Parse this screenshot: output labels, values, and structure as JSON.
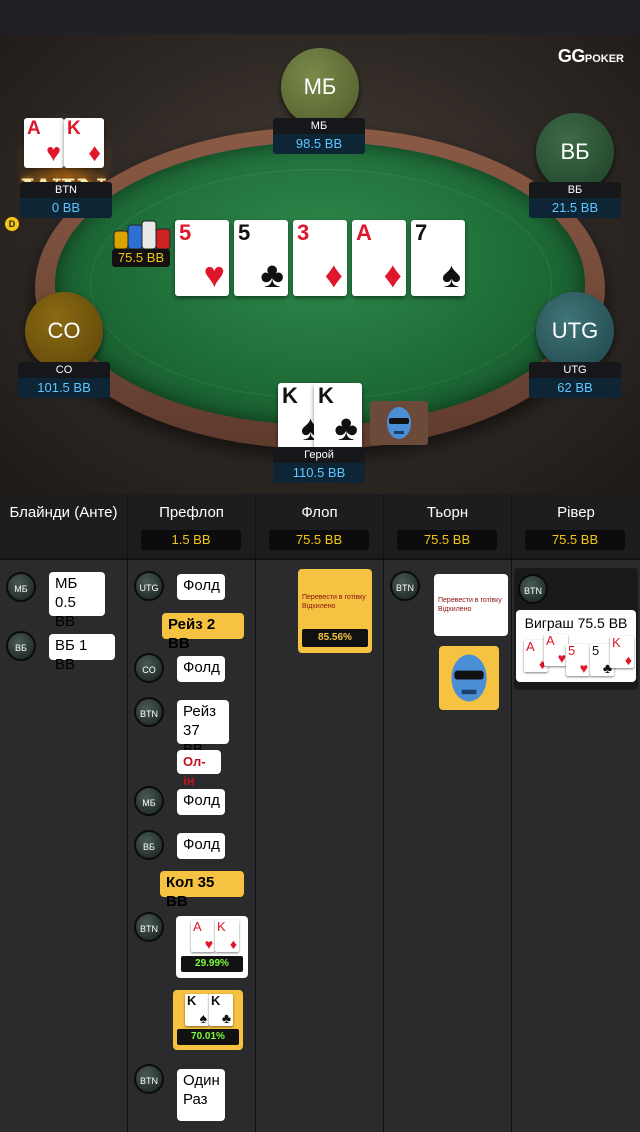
{
  "brand": {
    "logo": "GG",
    "logo_sub": "POKER"
  },
  "seats": {
    "sb": {
      "circle": "МБ",
      "name": "МБ",
      "stack": "98.5 BB"
    },
    "bb": {
      "circle": "ВБ",
      "name": "ВБ",
      "stack": "21.5 BB"
    },
    "utg": {
      "circle": "UTG",
      "name": "UTG",
      "stack": "62 BB"
    },
    "co": {
      "circle": "CO",
      "name": "CO",
      "stack": "101.5 BB"
    },
    "btn": {
      "name": "BTN",
      "stack": "0 BB",
      "win": "WIN",
      "dealer": "D",
      "cards": [
        {
          "rank": "A",
          "suit": "♥"
        },
        {
          "rank": "K",
          "suit": "♦"
        }
      ]
    },
    "hero": {
      "name": "Герой",
      "stack": "110.5 BB",
      "cards": [
        {
          "rank": "K",
          "suit": "♠"
        },
        {
          "rank": "K",
          "suit": "♣"
        }
      ]
    }
  },
  "pot": "75.5 BB",
  "board": [
    {
      "rank": "5",
      "suit": "♥",
      "color": "#e0162b"
    },
    {
      "rank": "5",
      "suit": "♣",
      "color": "#111111"
    },
    {
      "rank": "3",
      "suit": "♦",
      "color": "#e0162b"
    },
    {
      "rank": "A",
      "suit": "♦",
      "color": "#e0162b"
    },
    {
      "rank": "7",
      "suit": "♠",
      "color": "#111111"
    }
  ],
  "history": {
    "columns": [
      {
        "title": "Блайнди (Анте)",
        "pot": ""
      },
      {
        "title": "Префлоп",
        "pot": "1.5 BB"
      },
      {
        "title": "Флоп",
        "pot": "75.5 BB"
      },
      {
        "title": "Тьорн",
        "pot": "75.5 BB"
      },
      {
        "title": "Рівер",
        "pot": "75.5 BB"
      }
    ],
    "blinds": [
      {
        "pos": "МБ",
        "action": "МБ 0.5 BB"
      },
      {
        "pos": "ВБ",
        "action": "ВБ 1 BB"
      }
    ],
    "preflop": {
      "utg": {
        "pos": "UTG",
        "action": "Фолд"
      },
      "hero_raise": "Рейз 2 BB",
      "co": {
        "pos": "CO",
        "action": "Фолд"
      },
      "btn": {
        "pos": "BTN",
        "action": "Рейз 37 BB"
      },
      "allin": "Ол-ін",
      "sb": {
        "pos": "МБ",
        "action": "Фолд"
      },
      "bb": {
        "pos": "ВБ",
        "action": "Фолд"
      },
      "hero_call": "Кол 35 BB",
      "btn_show": {
        "pos": "BTN",
        "equity": "29.99%",
        "cards": [
          {
            "rank": "A",
            "suit": "♥"
          },
          {
            "rank": "K",
            "suit": "♦"
          }
        ]
      },
      "hero_show": {
        "equity": "70.01%",
        "cards": [
          {
            "rank": "K",
            "suit": "♠"
          },
          {
            "rank": "K",
            "suit": "♣"
          }
        ]
      },
      "run_once": {
        "pos": "BTN",
        "action": "Один Раз"
      }
    },
    "flop": {
      "message": "Перевести в готівку Відхилено",
      "equity": "85.56%"
    },
    "turn": {
      "pos": "BTN",
      "message": "Перевести в готівку Відхилено"
    },
    "river": {
      "pos": "BTN",
      "result": "Виграш 75.5 BB",
      "cards": [
        {
          "rank": "A",
          "suit": "♦"
        },
        {
          "rank": "A",
          "suit": "♥"
        },
        {
          "rank": "5",
          "suit": "♥"
        },
        {
          "rank": "5",
          "suit": "♣"
        },
        {
          "rank": "K",
          "suit": "♦"
        }
      ]
    }
  }
}
